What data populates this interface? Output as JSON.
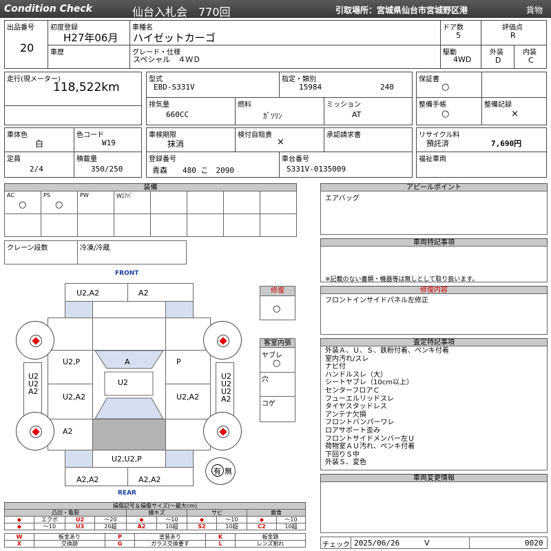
{
  "header": {
    "brand": "Condition  Check",
    "auction": "仙台入札会　770回",
    "pickup": "引取場所：宮城県仙台市宮城野区港",
    "cargo": "貨物"
  },
  "row1": {
    "lot_label": "出品番号",
    "lot_value": "20",
    "first_reg_label": "初度登録",
    "first_reg_value": "H27年06月",
    "name_label": "車種名",
    "name_value": "ハイゼットカーゴ",
    "doors_label": "ドア数",
    "doors_value": "5",
    "score_label": "評価点",
    "score_value": "R",
    "history_label": "車歴",
    "grade_label": "グレード・仕様",
    "grade_value": "スペシャル　４ＷＤ",
    "drive_label": "駆動",
    "drive_value": "4WD",
    "ext_label": "外装",
    "ext_value": "D",
    "int_label": "内装",
    "int_value": "C"
  },
  "row2": {
    "mileage_label": "走行(現メーター)",
    "mileage_value": "118,522km",
    "model_label": "型式",
    "model_value": "EBD-S331V",
    "designation_label": "指定・類別",
    "designation_value": "15984",
    "category_value": "240",
    "warranty_label": "保証書",
    "warranty_value": "○",
    "displacement_label": "排気量",
    "displacement_value": "660CC",
    "fuel_label": "燃料",
    "fuel_value": "ｶﾞｿﾘﾝ",
    "mission_label": "ミッション",
    "mission_value": "AT",
    "maint_label": "整備手帳",
    "maint_value": "○",
    "maint_rec_label": "整備記録",
    "maint_rec_value": "×"
  },
  "row3": {
    "body_color_label": "車体色",
    "body_color_value": "白",
    "color_code_label": "色コード",
    "color_code_value": "W19",
    "inspection_label": "車検期限",
    "inspection_value": "抹消",
    "insurance_label": "検付自賠責",
    "insurance_value": "×",
    "approval_label": "承認請求書",
    "recycle_label": "リサイクル料",
    "recycle_status": "預託済",
    "recycle_value": "7,690円",
    "capacity_label": "定員",
    "capacity_value": "2/4",
    "load_label": "積載量",
    "load_value": "350/250",
    "reg_no_label": "登録番号",
    "reg_no_value": "青森　　480 こ　2090",
    "chassis_label": "車台番号",
    "chassis_value": "S331V-0135009",
    "welfare_label": "福祉車両"
  },
  "equipment": {
    "title": "装備",
    "items": [
      {
        "label": "AC",
        "mark": "○"
      },
      {
        "label": "PS",
        "mark": "○"
      },
      {
        "label": "PW",
        "mark": ""
      },
      {
        "label": "Wｴｱﾊﾞ",
        "mark": ""
      }
    ],
    "crane_label": "クレーン段数",
    "freezer_label": "冷凍/冷蔵"
  },
  "appeal": {
    "title": "アピールポイント",
    "text": "エアバッグ"
  },
  "special": {
    "title": "車両特記事項",
    "note": "※記載のない書類・機器等は無しとして取り扱います。"
  },
  "repair": {
    "label": "修復",
    "mark": "○",
    "content_title": "修復内容",
    "content_text": "フロントインサイドパネル左修正"
  },
  "cabin": {
    "title": "客室内張",
    "tear_label": "ヤブレ",
    "tear_mark": "○",
    "hole_label": "穴",
    "burn_label": "コゲ"
  },
  "inspection_notes": {
    "title": "査定特記事項",
    "lines": [
      "外装Ａ、Ｕ、Ｓ、鉄粉付着、ペンキ付着",
      "室内汚れ/スレ",
      "ナビ付",
      "ハンドルスレ（大）",
      "シートヤブレ（10cm以上）",
      "センターフロアＣ",
      "フューエルリッドスレ",
      "タイヤスタッドレス",
      "アンテナ欠損",
      "フロントバンパーワレ",
      "ロアサポート歪み",
      "フロントサイドメンバー左Ｕ",
      "荷物室ＡＵ汚れ、ペンキ付着",
      "下回りＳ中",
      "外装Ｓ、変色"
    ]
  },
  "change_info": {
    "title": "車両変更情報"
  },
  "diagram": {
    "front_label": "FRONT",
    "rear_label": "REAR",
    "codes": {
      "front_left": "U2,A2",
      "front_right": "A2",
      "door_fl": "U2,P",
      "hood": "A",
      "door_fr": "P",
      "roof": "U2",
      "door_rl": "U2,A2",
      "door_rr": "U2,A2",
      "rear_left": "A2",
      "side_left": "U2\nU2\nA2",
      "side_right": "U2\nU2\nU2\nA2",
      "tailgate": "U2,U2,P",
      "rear_bumper_left": "A2,A2",
      "rear_bumper_right": "A2,A2"
    },
    "spare_present": "有",
    "spare_absent": "無"
  },
  "legend": {
    "title": "損傷記号＆損傷サイズ(〜最大cm)",
    "groups": [
      {
        "name": "凸凹・亀裂",
        "rows": [
          [
            "◆",
            "エクボ",
            "U2",
            "〜20"
          ],
          [
            "◆",
            "〜10",
            "U3",
            "20超"
          ]
        ]
      },
      {
        "name": "線キズ",
        "rows": [
          [
            "◆",
            "〜10",
            "A2",
            "10超"
          ]
        ]
      },
      {
        "name": "サビ",
        "rows": [
          [
            "◆",
            "〜10",
            "S2",
            "10超"
          ]
        ]
      },
      {
        "name": "腐食",
        "rows": [
          [
            "◆",
            "〜10",
            "C2",
            "10超"
          ]
        ]
      }
    ],
    "symbols": [
      {
        "code": "W",
        "text": "板金あり"
      },
      {
        "code": "P",
        "text": "塗装あり"
      },
      {
        "code": "K",
        "text": "板金跡"
      },
      {
        "code": "X",
        "text": "交換跡"
      },
      {
        "code": "G",
        "text": "ガラス交換要す"
      },
      {
        "code": "L",
        "text": "レンズ割れ"
      }
    ]
  },
  "check": {
    "label": "チェック",
    "date": "2025/06/26",
    "mark": "V",
    "number": "0020"
  }
}
